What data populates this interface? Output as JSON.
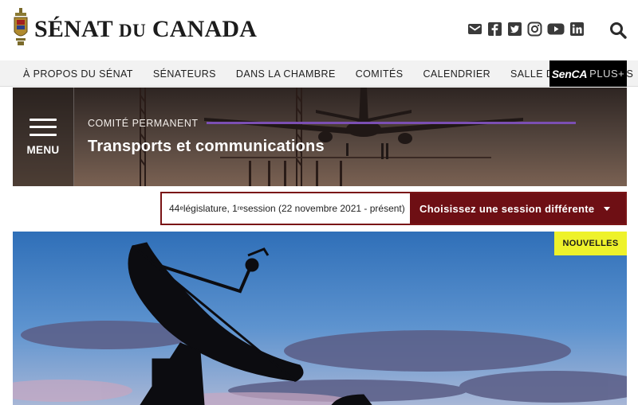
{
  "header": {
    "brand_main": "SÉNAT",
    "brand_du": "DU",
    "brand_end": "CANADA",
    "social_icons": [
      "envelope-icon",
      "facebook-icon",
      "twitter-icon",
      "instagram-icon",
      "youtube-icon",
      "linkedin-icon"
    ],
    "search_icon": "search-icon"
  },
  "nav": {
    "items": [
      {
        "label": "À PROPOS DU SÉNAT"
      },
      {
        "label": "SÉNATEURS"
      },
      {
        "label": "DANS LA CHAMBRE"
      },
      {
        "label": "COMITÉS"
      },
      {
        "label": "CALENDRIER"
      },
      {
        "label": "SALLE DES NOUVELLES"
      }
    ],
    "senca_a": "SenCA",
    "senca_b": "PLUS+"
  },
  "banner": {
    "menu_label": "MENU",
    "committee_type": "COMITÉ PERMANENT",
    "committee_name": "Transports et communications"
  },
  "session": {
    "legislature_num": "44",
    "legislature_sup": "e",
    "legislature_text": " législature, 1",
    "session_sup": "re",
    "session_text": " session (22 novembre 2021 - présent)",
    "button_label": "Choisissez une session différente"
  },
  "hero": {
    "badge": "NOUVELLES"
  },
  "colors": {
    "dark_red": "#6e0f14",
    "purple_accent": "#7b4fb3",
    "badge_yellow": "#eef22b",
    "nav_bg": "#f2f2f2"
  }
}
